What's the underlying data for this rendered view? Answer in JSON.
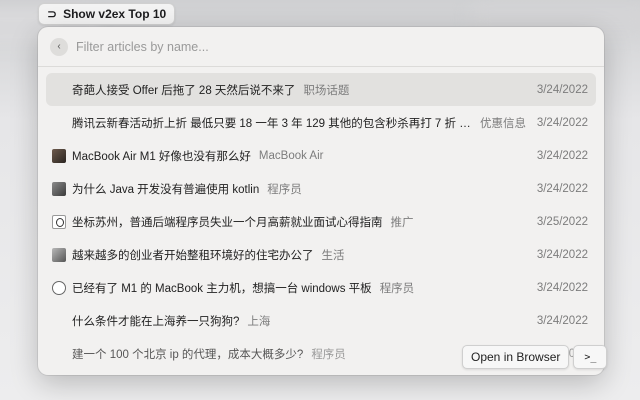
{
  "command": {
    "title": "Show v2ex Top 10",
    "icon": "extension-icon"
  },
  "search": {
    "placeholder": "Filter articles by name...",
    "value": ""
  },
  "articles": [
    {
      "title": "奇葩人接受 Offer 后拖了 28 天然后说不来了",
      "tag": "职场话题",
      "date": "3/24/2022",
      "icon": "blank"
    },
    {
      "title": "腾讯云新春活动折上折 最低只要 18 一年 3 年 129 其他的包含秒杀再打 7 折 不...",
      "tag": "优惠信息",
      "date": "3/24/2022",
      "icon": "blank"
    },
    {
      "title": "MacBook Air M1 好像也没有那么好",
      "tag": "MacBook Air",
      "date": "3/24/2022",
      "icon": "photo"
    },
    {
      "title": "为什么 Java 开发没有普遍使用 kotlin",
      "tag": "程序员",
      "date": "3/24/2022",
      "icon": "gray"
    },
    {
      "title": "坐标苏州，普通后端程序员失业一个月高薪就业面试心得指南",
      "tag": "推广",
      "date": "3/25/2022",
      "icon": "sketch"
    },
    {
      "title": "越来越多的创业者开始整租环境好的住宅办公了",
      "tag": "生活",
      "date": "3/24/2022",
      "icon": "mono"
    },
    {
      "title": "已经有了 M1 的 MacBook 主力机，想搞一台 windows 平板",
      "tag": "程序员",
      "date": "3/24/2022",
      "icon": "face"
    },
    {
      "title": "什么条件才能在上海养一只狗狗?",
      "tag": "上海",
      "date": "3/24/2022",
      "icon": "blank"
    },
    {
      "title": "建一个 100 个北京 ip 的代理，成本大概多少?",
      "tag": "程序员",
      "date": "3/24/2022",
      "icon": "blank"
    }
  ],
  "actions": {
    "open_label": "Open in Browser",
    "terminal_label": ">_"
  }
}
